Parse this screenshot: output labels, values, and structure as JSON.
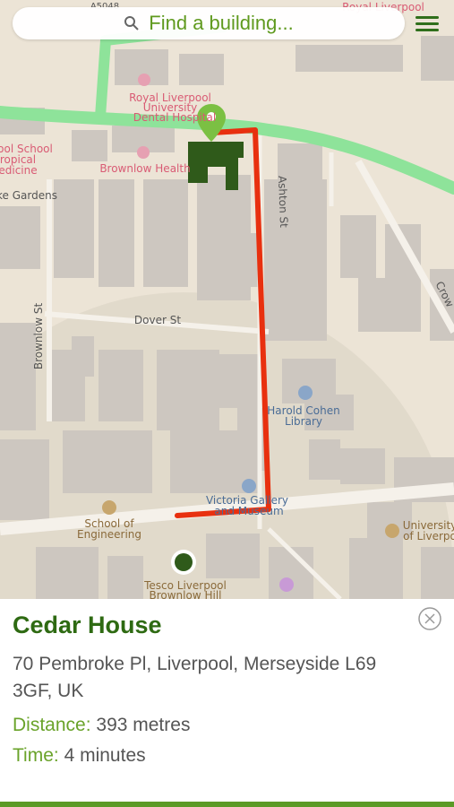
{
  "search": {
    "placeholder": "Find a building..."
  },
  "map": {
    "labels": {
      "royal_liverpool": "Royal Liverpool",
      "university": "University",
      "dental_hospital": "Dental Hospital",
      "brownlow_health": "Brownlow Health",
      "school_tropical_1": "ool School",
      "school_tropical_2": "ropical",
      "school_tropical_3": "edicine",
      "gardens": "ke Gardens",
      "ashton_st": "Ashton St",
      "dover_st": "Dover St",
      "brownlow_st": "Brownlow St",
      "harold_cohen_1": "Harold Cohen",
      "harold_cohen_2": "Library",
      "victoria_gallery_1": "Victoria Gallery",
      "victoria_gallery_2": "and Museum",
      "school_eng_1": "School of",
      "school_eng_2": "Engineering",
      "tesco_1": "Tesco Liverpool",
      "tesco_2": "Brownlow Hill",
      "univ_right_1": "University",
      "univ_right_2": "of Liverpo",
      "crown": "Crow",
      "royal_top": "Royal Liverpool",
      "road_num": "A5048"
    }
  },
  "details": {
    "name": "Cedar House",
    "address": "70 Pembroke Pl, Liverpool, Merseyside L69 3GF, UK",
    "distance_label": "Distance:",
    "distance_value": "393 metres",
    "time_label": "Time:",
    "time_value": "4 minutes"
  },
  "colors": {
    "accent_green": "#5f9a1e",
    "title_green": "#2e6a12",
    "route_red": "#e8300f",
    "highlight_road": "#8ee39a"
  },
  "icons": [
    "search-icon",
    "menu-icon",
    "location-pin-icon",
    "close-icon",
    "library-icon",
    "museum-icon"
  ]
}
